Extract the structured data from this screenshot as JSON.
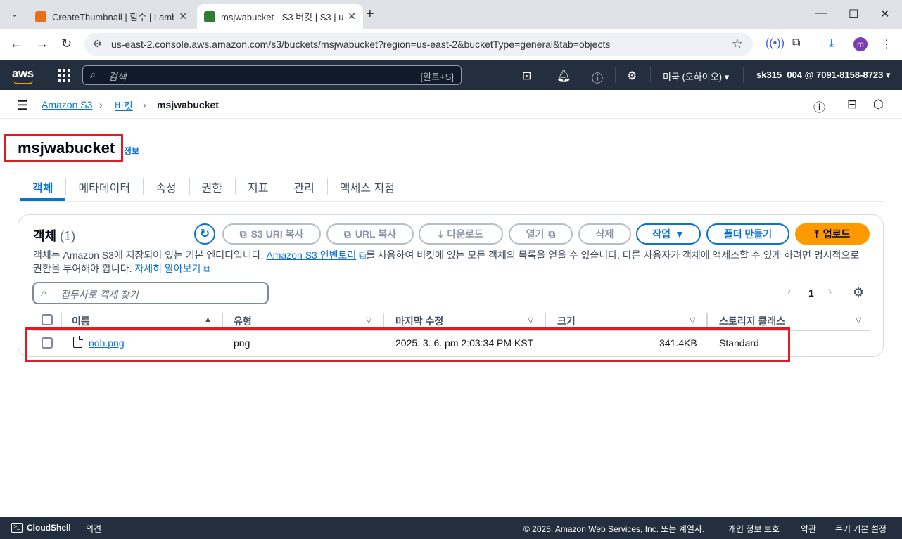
{
  "browser": {
    "tabs": [
      {
        "title": "CreateThumbnail | 함수 | Lamb",
        "favicon_color": "#e7711b"
      },
      {
        "title": "msjwabucket - S3 버킷 | S3 | u",
        "favicon_color": "#2e7d32"
      }
    ],
    "url": "us-east-2.console.aws.amazon.com/s3/buckets/msjwabucket?region=us-east-2&bucketType=general&tab=objects",
    "profile_initial": "m"
  },
  "aws_nav": {
    "logo": "aws",
    "search_placeholder": "검색",
    "search_shortcut": "[알트+S]",
    "region": "미국 (오하이오)",
    "account": "sk315_004 @ 7091-8158-8723"
  },
  "breadcrumb": {
    "items": [
      "Amazon S3",
      "버킷",
      "msjwabucket"
    ]
  },
  "page": {
    "title": "msjwabucket",
    "info_link": "정보",
    "tabs": [
      "객체",
      "메타데이터",
      "속성",
      "권한",
      "지표",
      "관리",
      "액세스 지점"
    ],
    "active_tab": 0
  },
  "objects_panel": {
    "title": "객체",
    "count": "(1)",
    "buttons": {
      "copy_s3_uri": "S3 URI 복사",
      "copy_url": "URL 복사",
      "download": "다운로드",
      "open": "열기",
      "delete": "삭제",
      "actions": "작업",
      "create_folder": "폴더 만들기",
      "upload": "업로드"
    },
    "description": {
      "part1": "객체는 Amazon S3에 저장되어 있는 기본 엔터티입니다. ",
      "link1": "Amazon S3 인벤토리",
      "part2": "를 사용하여 버킷에 있는 모든 객체의 목록을 얻을 수 있습니다. 다른 사용자가 객체에 액세스할 수 있게 하려면 명시적으로 권한을 부여해야 합니다. ",
      "link2": "자세히 알아보기"
    },
    "filter_placeholder": "접두사로 객체 찾기",
    "current_page": "1",
    "columns": [
      "이름",
      "유형",
      "마지막 수정",
      "크기",
      "스토리지 클래스"
    ],
    "rows": [
      {
        "name": "noh.png",
        "type": "png",
        "last_modified": "2025. 3. 6. pm 2:03:34 PM KST",
        "size": "341.4KB",
        "storage_class": "Standard"
      }
    ]
  },
  "footer": {
    "cloudshell": "CloudShell",
    "feedback": "의견",
    "copyright": "© 2025, Amazon Web Services, Inc. 또는 계열사.",
    "privacy": "개인 정보 보호",
    "terms": "약관",
    "cookies": "쿠키 기본 설정"
  },
  "colors": {
    "aws_dark": "#232f3e",
    "link_blue": "#0972d3",
    "upload_orange": "#ff9900",
    "highlight_red": "#e01b24"
  }
}
